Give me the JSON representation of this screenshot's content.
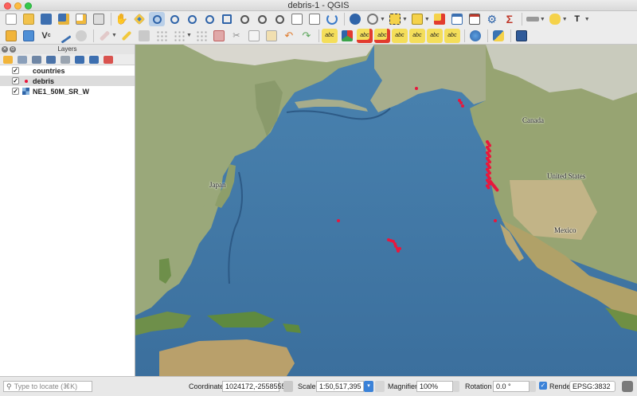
{
  "window": {
    "title": "debris-1 - QGIS"
  },
  "colors": {
    "debris": "#e8173d",
    "toolbar": "#ececec",
    "ocean": "#3f76a3"
  },
  "toolbar1": {
    "icons": [
      "new-project-icon",
      "open-project-icon",
      "save-project-icon",
      "save-as-icon",
      "print-layout-icon",
      "layout-manager-icon",
      "pan-icon",
      "pan-to-selection-icon",
      "zoom-in-icon",
      "zoom-out-icon",
      "zoom-full-icon",
      "zoom-to-selection-icon",
      "zoom-to-layer-icon",
      "zoom-native-icon",
      "zoom-last-icon",
      "zoom-next-icon",
      "new-map-view-icon",
      "refresh-icon",
      "identify-icon",
      "measure-icon",
      "select-icon",
      "attribute-table-icon",
      "statistics-icon",
      "field-calculator-icon",
      "settings-icon",
      "sum-icon",
      "annotation-icon",
      "tips-icon",
      "text-annotation-icon"
    ]
  },
  "toolbar2": {
    "icons": [
      "digitize-icon",
      "edit-layer-icon",
      "add-feature-icon",
      "node-tool-icon",
      "pencil-icon",
      "save-edits-icon",
      "move-feature-icon",
      "node-tool2-icon",
      "delete-icon",
      "cut-icon",
      "copy-icon",
      "paste-icon",
      "undo-icon",
      "redo-icon",
      "label-icon",
      "label-pin-icon",
      "label-highlight-icon",
      "label-move-icon",
      "label-rotate-icon",
      "label-change-icon",
      "label-show-icon",
      "label-tool-icon",
      "globe-icon",
      "python-icon",
      "help-icon"
    ],
    "label_text": "abc"
  },
  "layers_panel": {
    "title": "Layers",
    "items": [
      {
        "name": "countries",
        "checked": true,
        "selected": false,
        "icon": "polygon-icon"
      },
      {
        "name": "debris",
        "checked": true,
        "selected": true,
        "icon": "point-icon"
      },
      {
        "name": "NE1_50M_SR_W",
        "checked": true,
        "selected": false,
        "icon": "raster-icon"
      }
    ]
  },
  "map": {
    "labels": {
      "canada": "Canada",
      "united_states": "United States",
      "japan": "Japan",
      "mexico": "Mexico"
    }
  },
  "statusbar": {
    "locate_placeholder": "Type to locate (⌘K)",
    "coordinate_label": "Coordinate",
    "coordinate_value": "1024172,-2558555",
    "scale_label": "Scale",
    "scale_value": "1:50,517,395",
    "magnifier_label": "Magnifier",
    "magnifier_value": "100%",
    "rotation_label": "Rotation",
    "rotation_value": "0.0 °",
    "render_label": "Render",
    "render_checked": true,
    "crs_label": "EPSG:3832"
  }
}
